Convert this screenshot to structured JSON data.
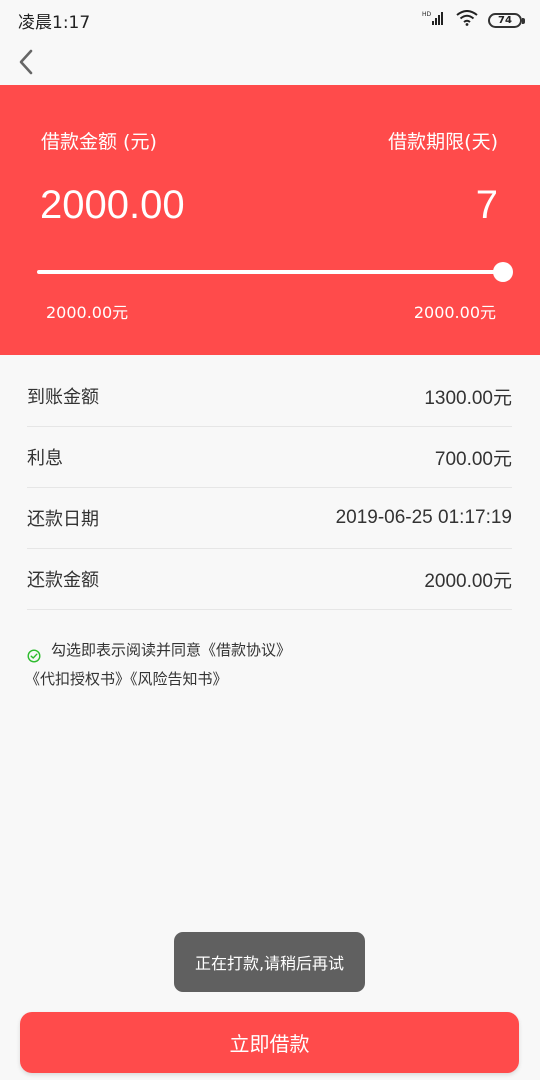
{
  "status_bar": {
    "time": "凌晨1:17",
    "network": "HD",
    "battery": "74"
  },
  "hero": {
    "amount_label": "借款金额 (元)",
    "term_label": "借款期限(天)",
    "amount": "2000.00",
    "term": "7",
    "slider_value": 1.0,
    "min_label": "2000.00元",
    "max_label": "2000.00元"
  },
  "rows": [
    {
      "label": "到账金额",
      "value": "1300.00元"
    },
    {
      "label": "利息",
      "value": "700.00元"
    },
    {
      "label": "还款日期",
      "value": "2019-06-25 01:17:19"
    },
    {
      "label": "还款金额",
      "value": "2000.00元"
    }
  ],
  "agreement": {
    "line1": "勾选即表示阅读并同意《借款协议》",
    "line2": "《代扣授权书》《风险告知书》",
    "check_color": "#2dbb2d"
  },
  "toast": {
    "text": "正在打款,请稍后再试"
  },
  "cta": {
    "label": "立即借款"
  },
  "colors": {
    "accent": "#ff4b4b",
    "toast_bg": "#606060"
  }
}
